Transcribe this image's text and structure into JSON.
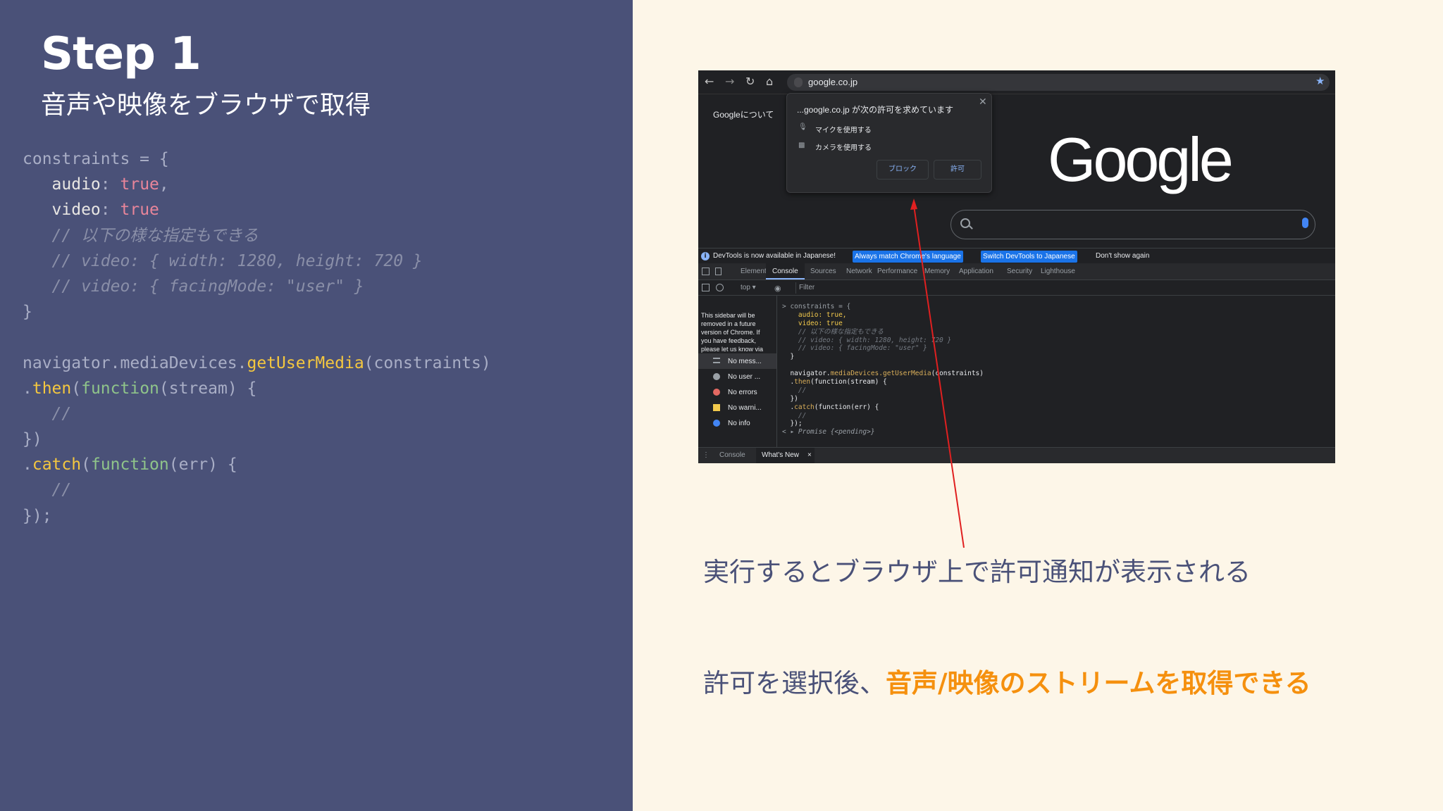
{
  "slide": {
    "title": "Step 1",
    "subtitle": "音声や映像をブラウザで取得"
  },
  "code": {
    "l1_id": "constraints",
    "l1_op": " = {",
    "l2_key": "audio",
    "l2_colon": ": ",
    "l2_val": "true",
    "l2_comma": ",",
    "l3_key": "video",
    "l3_colon": ": ",
    "l3_val": "true",
    "l4": "// 以下の様な指定もできる",
    "l5": "// video: { width: 1280, height: 720 }",
    "l6": "// video: { facingMode: \"user\" }",
    "l7": "}",
    "l9_obj": "navigator.mediaDevices.",
    "l9_fn": "getUserMedia",
    "l9_args": "(constraints)",
    "l10_dot": ".",
    "l10_fn": "then",
    "l10_paren": "(",
    "l10_kw": "function",
    "l10_rest": "(stream) {",
    "l11": "//",
    "l12": "})",
    "l13_dot": ".",
    "l13_fn": "catch",
    "l13_paren": "(",
    "l13_kw": "function",
    "l13_rest": "(err) {",
    "l14": "//",
    "l15": "});"
  },
  "browser": {
    "url": "google.co.jp",
    "about_link": "Googleについて",
    "logo": "Google",
    "icons": [
      "back-icon",
      "forward-icon",
      "reload-icon",
      "home-icon",
      "lock-icon",
      "star-icon",
      "search-icon",
      "mic-icon"
    ]
  },
  "permission_popup": {
    "title": "...google.co.jp が次の許可を求めています",
    "mic": "マイクを使用する",
    "camera": "カメラを使用する",
    "block": "ブロック",
    "allow": "許可"
  },
  "devtools": {
    "notice": "DevTools is now available in Japanese!",
    "match_btn": "Always match Chrome's language",
    "switch_btn": "Switch DevTools to Japanese",
    "dismiss": "Don't show again",
    "tabs": [
      "Elements",
      "Console",
      "Sources",
      "Network",
      "Performance",
      "Memory",
      "Application",
      "Security",
      "Lighthouse"
    ],
    "context": "top ▾",
    "filter_placeholder": "Filter",
    "sidebar_note": "This sidebar will be removed in a future version of Chrome. If you have feedback, please let us know via the",
    "sidebar_items": [
      "No mess...",
      "No user ...",
      "No errors",
      "No warni...",
      "No info"
    ],
    "drawer_tabs": [
      "Console",
      "What's New"
    ]
  },
  "console_code": {
    "c1": "> constraints = {",
    "c2": "    audio: true,",
    "c3": "    video: true",
    "c4": "    // 以下の様な指定もできる",
    "c5": "    // video: { width: 1280, height: 720 }",
    "c6": "    // video: { facingMode: \"user\" }",
    "c7": "  }",
    "c9_obj": "  navigator.",
    "c9_fn": "mediaDevices.getUserMedia",
    "c9_args": "(constraints)",
    "c10_dot": "  .",
    "c10_fn": "then",
    "c10_rest": "(function(stream) {",
    "c11": "    //",
    "c12": "  })",
    "c13_dot": "  .",
    "c13_fn": "catch",
    "c13_rest": "(function(err) {",
    "c14": "    //",
    "c15": "  });",
    "c16": "< ▸ Promise {<pending>}"
  },
  "captions": {
    "line1": "実行するとブラウザ上で許可通知が表示される",
    "line2_plain": "許可を選択後、",
    "line2_strong": "音声/映像のストリームを取得できる"
  },
  "colors": {
    "left_bg": "#4a5178",
    "right_bg": "#fdf6e8",
    "accent_orange": "#f5900e",
    "arrow_red": "#e02020"
  }
}
